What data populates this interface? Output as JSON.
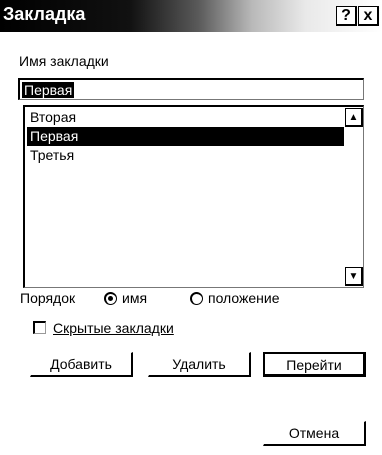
{
  "window": {
    "title": "Закладка",
    "help_glyph": "?",
    "close_glyph": "x"
  },
  "bookmark_name": {
    "label": "Имя закладки",
    "value": "Первая"
  },
  "bookmarks_list": {
    "items": [
      {
        "label": "Вторая",
        "selected": false
      },
      {
        "label": "Первая",
        "selected": true
      },
      {
        "label": "Третья",
        "selected": false
      }
    ],
    "scroll_up_glyph": "▲",
    "scroll_down_glyph": "▼"
  },
  "sort": {
    "label": "Порядок",
    "options": [
      {
        "label": "имя",
        "checked": true
      },
      {
        "label": "положение",
        "checked": false
      }
    ]
  },
  "hidden_bookmarks": {
    "label": "Скрытые закладки",
    "checked": false
  },
  "buttons": {
    "add": "Добавить",
    "delete": "Удалить",
    "go_to": "Перейти",
    "cancel": "Отмена"
  }
}
